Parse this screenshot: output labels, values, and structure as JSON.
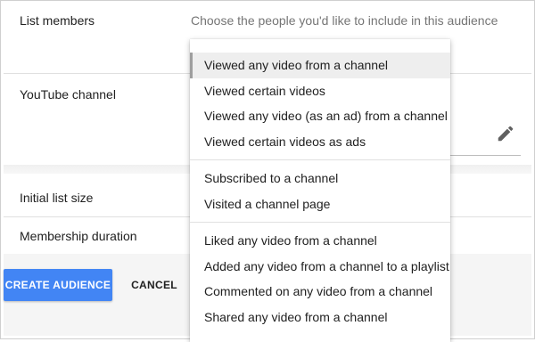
{
  "form": {
    "list_members_label": "List members",
    "list_members_hint": "Choose the people you'd like to include in this audience",
    "youtube_channel_label": "YouTube channel",
    "initial_list_size_label": "Initial list size",
    "membership_duration_label": "Membership duration"
  },
  "footer": {
    "create_label": "CREATE AUDIENCE",
    "cancel_label": "CANCEL"
  },
  "dropdown": {
    "selected_index": 0,
    "groups": [
      [
        "Viewed any video from a channel",
        "Viewed certain videos",
        "Viewed any video (as an ad) from a channel",
        "Viewed certain videos as ads"
      ],
      [
        "Subscribed to a channel",
        "Visited a channel page"
      ],
      [
        "Liked any video from a channel",
        "Added any video from a channel to a playlist",
        "Commented on any video from a channel",
        "Shared any video from a channel"
      ]
    ]
  },
  "icons": {
    "edit": "pencil-icon"
  },
  "colors": {
    "primary_button": "#4285f4"
  }
}
